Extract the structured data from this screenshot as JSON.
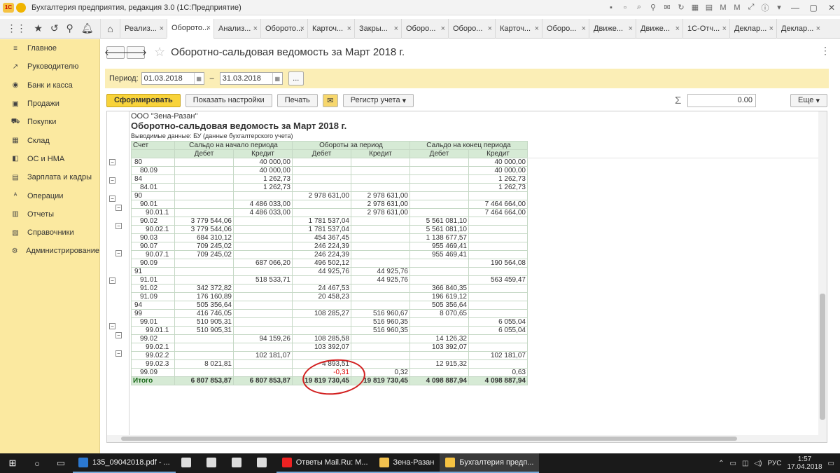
{
  "window": {
    "title": "Бухгалтерия предприятия, редакция 3.0  (1С:Предприятие)",
    "logo_text": "1С"
  },
  "tabs": [
    {
      "label": "Реализ..."
    },
    {
      "label": "Оборото...",
      "active": true
    },
    {
      "label": "Анализ..."
    },
    {
      "label": "Оборото..."
    },
    {
      "label": "Карточ..."
    },
    {
      "label": "Закры..."
    },
    {
      "label": "Оборо..."
    },
    {
      "label": "Оборо..."
    },
    {
      "label": "Карточ..."
    },
    {
      "label": "Оборо..."
    },
    {
      "label": "Движе..."
    },
    {
      "label": "Движе..."
    },
    {
      "label": "1С-Отч..."
    },
    {
      "label": "Деклар..."
    },
    {
      "label": "Деклар..."
    }
  ],
  "sidebar": {
    "items": [
      {
        "label": "Главное",
        "icon": "menu-icon"
      },
      {
        "label": "Руководителю",
        "icon": "trend-icon"
      },
      {
        "label": "Банк и касса",
        "icon": "bank-icon"
      },
      {
        "label": "Продажи",
        "icon": "sales-icon"
      },
      {
        "label": "Покупки",
        "icon": "cart-icon"
      },
      {
        "label": "Склад",
        "icon": "warehouse-icon"
      },
      {
        "label": "ОС и НМА",
        "icon": "assets-icon"
      },
      {
        "label": "Зарплата и кадры",
        "icon": "staff-icon"
      },
      {
        "label": "Операции",
        "icon": "operations-icon"
      },
      {
        "label": "Отчеты",
        "icon": "reports-icon"
      },
      {
        "label": "Справочники",
        "icon": "catalog-icon"
      },
      {
        "label": "Администрирование",
        "icon": "admin-icon"
      }
    ]
  },
  "page": {
    "title": "Оборотно-сальдовая ведомость за Март 2018 г."
  },
  "period": {
    "label": "Период:",
    "from": "01.03.2018",
    "dash": "–",
    "to": "31.03.2018",
    "dots": "..."
  },
  "toolbar": {
    "generate": "Сформировать",
    "settings": "Показать настройки",
    "print": "Печать",
    "register": "Регистр учета",
    "sum": "0.00",
    "more": "Еще"
  },
  "report": {
    "org": "ООО \"Зена-Разан\"",
    "title": "Оборотно-сальдовая ведомость за Март 2018 г.",
    "subtitle": "Выводимые данные:  БУ (данные бухгалтерского учета)",
    "header": {
      "account": "Счет",
      "opening": "Сальдо на начало периода",
      "turnover": "Обороты за период",
      "closing": "Сальдо на конец периода",
      "debit": "Дебет",
      "credit": "Кредит"
    },
    "rows": [
      {
        "acc": "80",
        "indent": 0,
        "od": "",
        "oc": "40 000,00",
        "td": "",
        "tc": "",
        "cd": "",
        "cc": "40 000,00"
      },
      {
        "acc": "80.09",
        "indent": 1,
        "od": "",
        "oc": "40 000,00",
        "td": "",
        "tc": "",
        "cd": "",
        "cc": "40 000,00"
      },
      {
        "acc": "84",
        "indent": 0,
        "od": "",
        "oc": "1 262,73",
        "td": "",
        "tc": "",
        "cd": "",
        "cc": "1 262,73"
      },
      {
        "acc": "84.01",
        "indent": 1,
        "od": "",
        "oc": "1 262,73",
        "td": "",
        "tc": "",
        "cd": "",
        "cc": "1 262,73"
      },
      {
        "acc": "90",
        "indent": 0,
        "od": "",
        "oc": "",
        "td": "2 978 631,00",
        "tc": "2 978 631,00",
        "cd": "",
        "cc": ""
      },
      {
        "acc": "90.01",
        "indent": 1,
        "od": "",
        "oc": "4 486 033,00",
        "td": "",
        "tc": "2 978 631,00",
        "cd": "",
        "cc": "7 464 664,00"
      },
      {
        "acc": "90.01.1",
        "indent": 2,
        "od": "",
        "oc": "4 486 033,00",
        "td": "",
        "tc": "2 978 631,00",
        "cd": "",
        "cc": "7 464 664,00"
      },
      {
        "acc": "90.02",
        "indent": 1,
        "od": "3 779 544,06",
        "oc": "",
        "td": "1 781 537,04",
        "tc": "",
        "cd": "5 561 081,10",
        "cc": ""
      },
      {
        "acc": "90.02.1",
        "indent": 2,
        "od": "3 779 544,06",
        "oc": "",
        "td": "1 781 537,04",
        "tc": "",
        "cd": "5 561 081,10",
        "cc": ""
      },
      {
        "acc": "90.03",
        "indent": 1,
        "od": "684 310,12",
        "oc": "",
        "td": "454 367,45",
        "tc": "",
        "cd": "1 138 677,57",
        "cc": ""
      },
      {
        "acc": "90.07",
        "indent": 1,
        "od": "709 245,02",
        "oc": "",
        "td": "246 224,39",
        "tc": "",
        "cd": "955 469,41",
        "cc": ""
      },
      {
        "acc": "90.07.1",
        "indent": 2,
        "od": "709 245,02",
        "oc": "",
        "td": "246 224,39",
        "tc": "",
        "cd": "955 469,41",
        "cc": ""
      },
      {
        "acc": "90.09",
        "indent": 1,
        "od": "",
        "oc": "687 066,20",
        "td": "496 502,12",
        "tc": "",
        "cd": "",
        "cc": "190 564,08"
      },
      {
        "acc": "91",
        "indent": 0,
        "od": "",
        "oc": "",
        "td": "44 925,76",
        "tc": "44 925,76",
        "cd": "",
        "cc": ""
      },
      {
        "acc": "91.01",
        "indent": 1,
        "od": "",
        "oc": "518 533,71",
        "td": "",
        "tc": "44 925,76",
        "cd": "",
        "cc": "563 459,47"
      },
      {
        "acc": "91.02",
        "indent": 1,
        "od": "342 372,82",
        "oc": "",
        "td": "24 467,53",
        "tc": "",
        "cd": "366 840,35",
        "cc": ""
      },
      {
        "acc": "91.09",
        "indent": 1,
        "od": "176 160,89",
        "oc": "",
        "td": "20 458,23",
        "tc": "",
        "cd": "196 619,12",
        "cc": ""
      },
      {
        "acc": "94",
        "indent": 0,
        "od": "505 356,64",
        "oc": "",
        "td": "",
        "tc": "",
        "cd": "505 356,64",
        "cc": ""
      },
      {
        "acc": "99",
        "indent": 0,
        "od": "416 746,05",
        "oc": "",
        "td": "108 285,27",
        "tc": "516 960,67",
        "cd": "8 070,65",
        "cc": ""
      },
      {
        "acc": "99.01",
        "indent": 1,
        "od": "510 905,31",
        "oc": "",
        "td": "",
        "tc": "516 960,35",
        "cd": "",
        "cc": "6 055,04"
      },
      {
        "acc": "99.01.1",
        "indent": 2,
        "od": "510 905,31",
        "oc": "",
        "td": "",
        "tc": "516 960,35",
        "cd": "",
        "cc": "6 055,04"
      },
      {
        "acc": "99.02",
        "indent": 1,
        "od": "",
        "oc": "94 159,26",
        "td": "108 285,58",
        "tc": "",
        "cd": "14 126,32",
        "cc": ""
      },
      {
        "acc": "99.02.1",
        "indent": 2,
        "od": "",
        "oc": "",
        "td": "103 392,07",
        "tc": "",
        "cd": "103 392,07",
        "cc": ""
      },
      {
        "acc": "99.02.2",
        "indent": 2,
        "od": "",
        "oc": "102 181,07",
        "td": "",
        "tc": "",
        "cd": "",
        "cc": "102 181,07"
      },
      {
        "acc": "99.02.3",
        "indent": 2,
        "od": "8 021,81",
        "oc": "",
        "td": "4 893,51",
        "tc": "",
        "cd": "12 915,32",
        "cc": ""
      },
      {
        "acc": "99.09",
        "indent": 1,
        "od": "",
        "oc": "",
        "td": "-0,31",
        "tc": "0,32",
        "cd": "",
        "cc": "0,63",
        "td_red": true
      }
    ],
    "total": {
      "acc": "Итого",
      "od": "6 807 853,87",
      "oc": "6 807 853,87",
      "td": "19 819 730,45",
      "tc": "19 819 730,45",
      "cd": "4 098 887,94",
      "cc": "4 098 887,94"
    }
  },
  "taskbar": {
    "apps": [
      {
        "label": "135_09042018.pdf - ...",
        "icon": "edge-icon",
        "color": "#2b78d0",
        "state": "open"
      },
      {
        "label": "",
        "icon": "store-icon",
        "color": "#ddd",
        "state": ""
      },
      {
        "label": "",
        "icon": "media-icon",
        "color": "#ddd",
        "state": ""
      },
      {
        "label": "",
        "icon": "chrome-icon",
        "color": "#ddd",
        "state": ""
      },
      {
        "label": "",
        "icon": "save-icon",
        "color": "#ddd",
        "state": ""
      },
      {
        "label": "Ответы Mail.Ru: M...",
        "icon": "yandex-icon",
        "color": "#e22",
        "state": "open"
      },
      {
        "label": "Зена-Разан",
        "icon": "folder-icon",
        "color": "#f2c14e",
        "state": "open"
      },
      {
        "label": "Бухгалтерия предп...",
        "icon": "onec-icon",
        "color": "#f5c242",
        "state": "active"
      }
    ],
    "lang": "РУС",
    "time": "1:57",
    "date": "17.04.2018"
  }
}
